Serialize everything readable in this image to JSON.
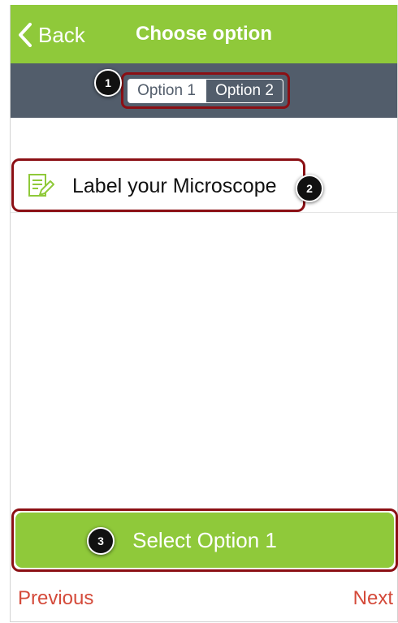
{
  "nav": {
    "back_label": "Back",
    "title": "Choose option"
  },
  "segments": [
    {
      "label": "Option 1",
      "selected": true
    },
    {
      "label": "Option 2",
      "selected": false
    }
  ],
  "list": {
    "items": [
      {
        "label": "Label your Microscope",
        "icon": "edit-document-icon"
      }
    ]
  },
  "select_button": {
    "label": "Select Option 1"
  },
  "footer": {
    "previous_label": "Previous",
    "next_label": "Next"
  },
  "callouts": [
    "1",
    "2",
    "3"
  ],
  "colors": {
    "brand_green": "#8fc93a",
    "segment_bar": "#525d6b",
    "callout_outline": "#8b0f14",
    "pager_text": "#d44a3a"
  }
}
